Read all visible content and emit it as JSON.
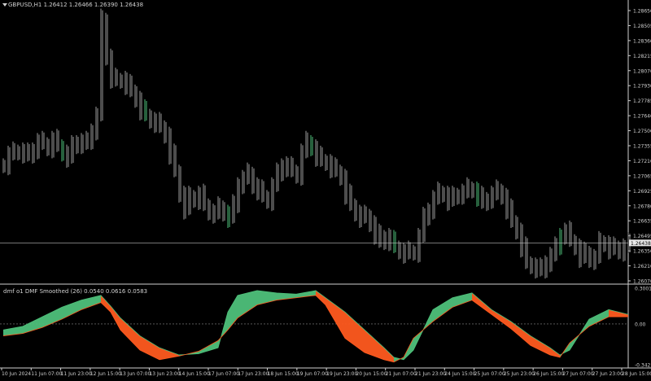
{
  "chart_data": [
    {
      "type": "candlestick",
      "title": "GBPUSD,H1  1.26412 1.26466 1.26390 1.26438",
      "symbol": "GBPUSD",
      "timeframe": "H1",
      "ohlc_label": "1.26412 1.26466 1.26390 1.26438",
      "current_price": "1.26438",
      "yticks": [
        "1.28650",
        "1.28505",
        "1.28360",
        "1.28215",
        "1.28070",
        "1.27930",
        "1.27785",
        "1.27640",
        "1.27500",
        "1.27355",
        "1.27210",
        "1.27065",
        "1.26925",
        "1.26780",
        "1.26635",
        "1.26495",
        "1.26350",
        "1.26210",
        "1.26070"
      ],
      "ylim": [
        1.2607,
        1.2868
      ],
      "x": [
        0,
        6,
        12,
        18,
        24,
        30,
        36,
        42,
        48,
        54,
        60,
        66,
        72,
        78,
        84,
        90,
        96,
        102,
        108,
        114,
        120,
        126,
        132,
        138,
        144,
        150,
        156,
        162,
        168,
        174,
        180,
        186,
        192,
        198,
        204,
        210,
        216,
        222,
        228,
        234,
        240,
        246,
        252,
        258,
        264,
        270,
        276,
        282,
        288,
        294,
        300,
        306,
        312,
        318,
        324,
        330,
        336,
        342,
        348,
        354,
        360,
        366,
        372,
        378,
        384,
        390,
        396,
        402,
        408,
        414,
        420,
        426,
        432,
        438,
        444,
        450,
        456,
        462,
        468,
        474,
        480,
        486,
        492,
        498,
        504,
        510,
        516,
        522,
        528,
        534,
        540,
        546,
        552,
        558,
        564,
        570,
        576,
        582,
        588,
        594,
        600,
        606,
        612,
        618,
        624,
        630,
        636,
        642,
        648,
        654,
        660,
        666,
        672,
        678,
        684,
        690,
        696,
        702,
        708,
        714,
        720,
        726,
        732,
        738,
        744,
        750,
        756,
        762,
        768
      ],
      "close": [
        1.2718,
        1.2728,
        1.273,
        1.2731,
        1.2729,
        1.2727,
        1.2733,
        1.274,
        1.2738,
        1.2734,
        1.2742,
        1.2736,
        1.2729,
        1.2725,
        1.2736,
        1.274,
        1.2738,
        1.274,
        1.2751,
        1.2765,
        1.2856,
        1.282,
        1.28,
        1.2798,
        1.2799,
        1.2794,
        1.2788,
        1.278,
        1.277,
        1.2765,
        1.276,
        1.2758,
        1.2754,
        1.2746,
        1.2728,
        1.2712,
        1.269,
        1.2676,
        1.2688,
        1.2685,
        1.269,
        1.268,
        1.2673,
        1.2672,
        1.2678,
        1.2672,
        1.2668,
        1.268,
        1.27,
        1.2705,
        1.271,
        1.2698,
        1.2694,
        1.2688,
        1.2684,
        1.2698,
        1.271,
        1.2718,
        1.2716,
        1.2712,
        1.2708,
        1.273,
        1.274,
        1.2734,
        1.2726,
        1.2722,
        1.272,
        1.2715,
        1.2712,
        1.2706,
        1.269,
        1.268,
        1.2672,
        1.2668,
        1.267,
        1.2662,
        1.2652,
        1.2645,
        1.265,
        1.2646,
        1.264,
        1.2636,
        1.2634,
        1.2636,
        1.2635,
        1.265,
        1.2668,
        1.2676,
        1.2686,
        1.2692,
        1.269,
        1.2684,
        1.2688,
        1.269,
        1.2692,
        1.2696,
        1.2694,
        1.2688,
        1.2682,
        1.2686,
        1.269,
        1.2694,
        1.2688,
        1.2676,
        1.2664,
        1.2655,
        1.264,
        1.2625,
        1.2622,
        1.262,
        1.2618,
        1.2626,
        1.2632,
        1.264,
        1.2652,
        1.2655,
        1.2646,
        1.264,
        1.263,
        1.2635,
        1.2628,
        1.263,
        1.2645,
        1.2643,
        1.2638,
        1.264,
        1.2636,
        1.264,
        1.2644
      ],
      "indicator": {
        "title": "dmf o1 DMF Smoothed (26) 0.0540 0.0616 0.0583",
        "yticks": [
          "0.3001",
          "0.00",
          "-0.3423"
        ],
        "ylim": [
          -0.3423,
          0.3001
        ],
        "x": [
          0,
          24,
          48,
          72,
          96,
          120,
          132,
          144,
          168,
          192,
          216,
          240,
          264,
          276,
          288,
          312,
          336,
          360,
          384,
          396,
          420,
          444,
          468,
          480,
          492,
          504,
          528,
          552,
          576,
          600,
          624,
          648,
          672,
          684,
          696,
          720,
          744,
          768
        ],
        "upper": [
          -0.05,
          -0.02,
          0.06,
          0.14,
          0.2,
          0.24,
          0.15,
          0.05,
          -0.1,
          -0.2,
          -0.26,
          -0.25,
          -0.2,
          0.1,
          0.24,
          0.28,
          0.26,
          0.25,
          0.28,
          0.22,
          0.1,
          -0.05,
          -0.2,
          -0.28,
          -0.3,
          -0.22,
          0.12,
          0.22,
          0.26,
          0.12,
          0.02,
          -0.1,
          -0.2,
          -0.26,
          -0.22,
          0.04,
          0.12,
          0.08
        ],
        "lower": [
          -0.1,
          -0.08,
          -0.03,
          0.04,
          0.12,
          0.18,
          0.1,
          -0.05,
          -0.22,
          -0.3,
          -0.27,
          -0.23,
          -0.14,
          -0.05,
          0.05,
          0.16,
          0.2,
          0.22,
          0.24,
          0.16,
          -0.12,
          -0.24,
          -0.3,
          -0.32,
          -0.28,
          -0.12,
          0.02,
          0.14,
          0.2,
          0.08,
          -0.04,
          -0.18,
          -0.26,
          -0.28,
          -0.16,
          -0.02,
          0.06,
          0.06
        ]
      },
      "x_labels": [
        "10 Jun 2024",
        "11 Jun 07:00",
        "11 Jun 23:00",
        "12 Jun 15:00",
        "13 Jun 07:00",
        "13 Jun 23:00",
        "14 Jun 15:00",
        "17 Jun 07:00",
        "17 Jun 23:00",
        "18 Jun 15:00",
        "19 Jun 07:00",
        "19 Jun 23:00",
        "20 Jun 15:00",
        "21 Jun 07:00",
        "21 Jun 23:00",
        "24 Jun 15:00",
        "25 Jun 07:00",
        "25 Jun 23:00",
        "26 Jun 15:00",
        "27 Jun 07:00",
        "27 Jun 23:00",
        "28 Jun 15:00"
      ],
      "colors": {
        "bull": "#4ec07a",
        "bear": "#ff5a1f",
        "bars": "#9a9a9a",
        "axis": "#cfcfcf"
      }
    }
  ]
}
